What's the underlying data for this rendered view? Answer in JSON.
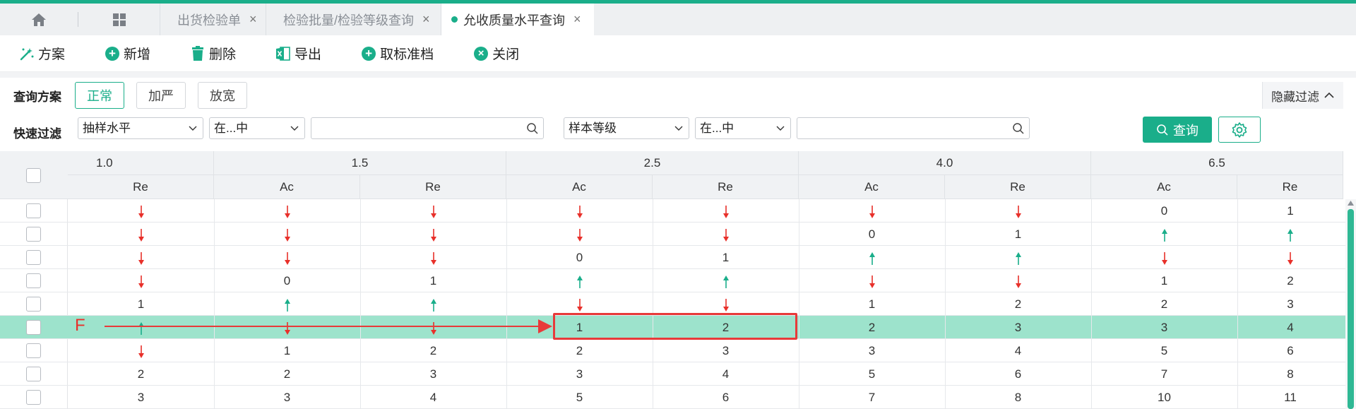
{
  "tabs": {
    "home_icon": "home-icon",
    "grid_icon": "apps-icon",
    "items": [
      {
        "label": "出货检验单",
        "active": false
      },
      {
        "label": "检验批量/检验等级查询",
        "active": false
      },
      {
        "label": "允收质量水平查询",
        "active": true
      }
    ],
    "close_glyph": "×"
  },
  "toolbar": {
    "scheme": "方案",
    "add": "新增",
    "delete": "删除",
    "export": "导出",
    "cancel_archive": "取标准档",
    "close": "关闭"
  },
  "query_scheme": {
    "label": "查询方案",
    "options": [
      "正常",
      "加严",
      "放宽"
    ],
    "selected": "正常",
    "hide_filter": "隐藏过滤"
  },
  "quick_filter": {
    "label": "快速过滤",
    "field1": "抽样水平",
    "op1": "在...中",
    "value1": "",
    "field2": "样本等级",
    "op2": "在...中",
    "value2": "",
    "query_button": "查询"
  },
  "grid": {
    "groups": [
      "1.0",
      "1.5",
      "2.5",
      "4.0",
      "6.5"
    ],
    "sub_headers": [
      "Re",
      "Ac",
      "Re",
      "Ac",
      "Re",
      "Ac",
      "Re",
      "Ac",
      "Re"
    ],
    "rows": [
      [
        "D",
        "D",
        "D",
        "D",
        "D",
        "D",
        "D",
        "0",
        "1"
      ],
      [
        "D",
        "D",
        "D",
        "D",
        "D",
        "0",
        "1",
        "U",
        "U"
      ],
      [
        "D",
        "D",
        "D",
        "0",
        "1",
        "U",
        "U",
        "D",
        "D"
      ],
      [
        "D",
        "0",
        "1",
        "U",
        "U",
        "D",
        "D",
        "1",
        "2"
      ],
      [
        "1",
        "U",
        "U",
        "D",
        "D",
        "1",
        "2",
        "2",
        "3"
      ],
      [
        "U",
        "D",
        "D",
        "1",
        "2",
        "2",
        "3",
        "3",
        "4"
      ],
      [
        "D",
        "1",
        "2",
        "2",
        "3",
        "3",
        "4",
        "5",
        "6"
      ],
      [
        "2",
        "2",
        "3",
        "3",
        "4",
        "5",
        "6",
        "7",
        "8"
      ],
      [
        "3",
        "3",
        "4",
        "5",
        "6",
        "7",
        "8",
        "10",
        "11"
      ]
    ],
    "selected_row": 5
  },
  "annotation": {
    "letter": "F"
  },
  "colors": {
    "accent": "#1aae8a",
    "arrow_down": "#e8302a",
    "arrow_up": "#1aae8a",
    "selected_row": "#9de3cc",
    "annotation": "#e83a3a"
  }
}
